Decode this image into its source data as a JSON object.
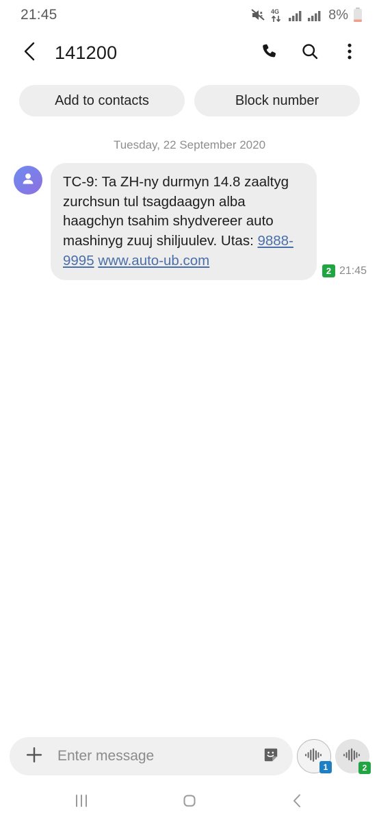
{
  "status_bar": {
    "time": "21:45",
    "network_label": "4G",
    "battery_percent": "8%",
    "icons": [
      "mute-icon",
      "data-4g-plus-icon",
      "signal-bars-sim1-icon",
      "signal-bars-sim2-icon",
      "battery-icon"
    ]
  },
  "header": {
    "title": "141200",
    "back_icon": "back-chevron-icon",
    "call_icon": "phone-icon",
    "search_icon": "search-icon",
    "menu_icon": "overflow-menu-icon"
  },
  "actions": {
    "add_to_contacts": "Add to contacts",
    "block_number": "Block number"
  },
  "conversation": {
    "date_separator": "Tuesday, 22 September 2020",
    "messages": [
      {
        "sender": "incoming",
        "avatar_icon": "person-avatar-icon",
        "text_part1": "TC-9: Ta ZH-ny durmyn 14.8 zaaltyg zurchsun tul tsagdaagyn alba haagchyn tsahim shydvereer auto mashinyg zuuj shiljuulev. Utas: ",
        "link_phone": "9888-9995",
        "link_url": "www.auto-ub.com",
        "sim_badge": "2",
        "time": "21:45"
      }
    ]
  },
  "input_bar": {
    "plus_icon": "plus-icon",
    "placeholder": "Enter message",
    "value": "",
    "sticker_icon": "sticker-icon",
    "send_sim1_icon": "voice-wave-icon",
    "send_sim1_badge": "1",
    "send_sim2_icon": "voice-wave-icon",
    "send_sim2_badge": "2"
  },
  "nav_bar": {
    "recents_icon": "recents-icon",
    "home_icon": "home-icon",
    "back_icon": "nav-back-icon"
  },
  "colors": {
    "bubble_bg": "#ededed",
    "pill_bg": "#eeeeee",
    "link": "#4a6ea8",
    "sim1_badge": "#1d7fc4",
    "sim2_badge": "#21a442",
    "avatar_gradient_start": "#6d8cf0",
    "avatar_gradient_end": "#8e6fe0"
  }
}
